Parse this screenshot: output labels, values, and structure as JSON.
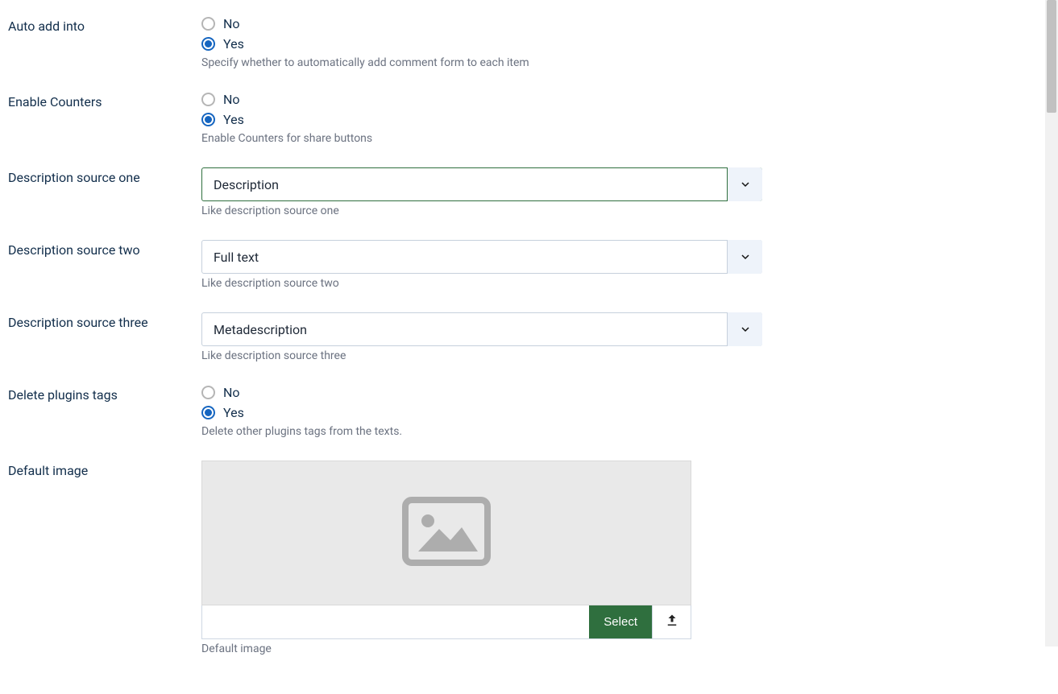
{
  "common": {
    "no": "No",
    "yes": "Yes"
  },
  "autoAdd": {
    "label": "Auto add into",
    "hint": "Specify whether to automatically add comment form to each item",
    "selected": "yes"
  },
  "enableCounters": {
    "label": "Enable Counters",
    "hint": "Enable Counters for share buttons",
    "selected": "yes"
  },
  "descOne": {
    "label": "Description source one",
    "value": "Description",
    "hint": "Like description source one"
  },
  "descTwo": {
    "label": "Description source two",
    "value": "Full text",
    "hint": "Like description source two"
  },
  "descThree": {
    "label": "Description source three",
    "value": "Metadescription",
    "hint": "Like description source three"
  },
  "deleteTags": {
    "label": "Delete plugins tags",
    "hint": "Delete other plugins tags from the texts.",
    "selected": "yes"
  },
  "defaultImage": {
    "label": "Default image",
    "path": "",
    "selectButton": "Select",
    "hint": "Default image"
  }
}
